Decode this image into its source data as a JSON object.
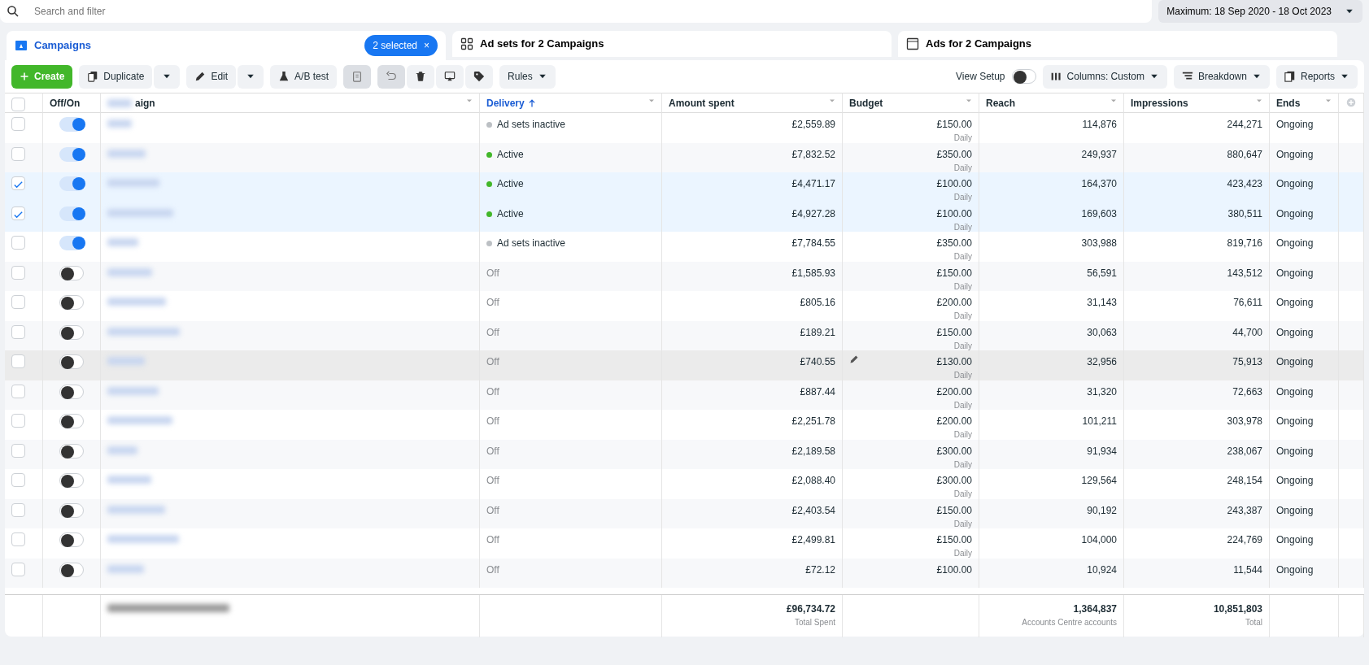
{
  "search": {
    "placeholder": "Search and filter"
  },
  "date_range": {
    "label": "Maximum: 18 Sep 2020 - 18 Oct 2023"
  },
  "tabs": [
    {
      "kind": "campaigns",
      "label": "Campaigns",
      "selected": true,
      "selection_chip": "2 selected",
      "chip_close": "×"
    },
    {
      "kind": "adsets",
      "label": "Ad sets for 2 Campaigns",
      "selected": false
    },
    {
      "kind": "ads",
      "label": "Ads for 2 Campaigns",
      "selected": false
    }
  ],
  "toolbar": {
    "create": "Create",
    "duplicate": "Duplicate",
    "edit": "Edit",
    "ab_test": "A/B test",
    "rules": "Rules",
    "view_setup": {
      "label": "View Setup",
      "on": false
    },
    "columns": "Columns: Custom",
    "breakdown": "Breakdown",
    "reports": "Reports"
  },
  "table": {
    "select_all_checked": false,
    "columns": [
      {
        "kind": "onoff",
        "label": "Off/On",
        "sorted": false
      },
      {
        "kind": "name",
        "label": "aign",
        "sorted": false
      },
      {
        "kind": "text",
        "label": "Delivery",
        "sorted": true
      },
      {
        "kind": "num",
        "label": "Amount spent",
        "sorted": false
      },
      {
        "kind": "num",
        "label": "Budget",
        "sorted": false
      },
      {
        "kind": "num",
        "label": "Reach",
        "sorted": false
      },
      {
        "kind": "num",
        "label": "Impressions",
        "sorted": false
      },
      {
        "kind": "text",
        "label": "Ends",
        "sorted": false
      }
    ],
    "rows": [
      {
        "selected": false,
        "on": true,
        "hovered": false,
        "delivery": "Ad sets inactive",
        "color": "#bcc0c4",
        "amount": "£2,559.89",
        "budget": "£150.00",
        "budget_period": "Daily",
        "reach": "114,876",
        "impressions": "244,271",
        "ends": "Ongoing"
      },
      {
        "selected": false,
        "on": true,
        "hovered": false,
        "delivery": "Active",
        "color": "#42b72a",
        "amount": "£7,832.52",
        "budget": "£350.00",
        "budget_period": "Daily",
        "reach": "249,937",
        "impressions": "880,647",
        "ends": "Ongoing"
      },
      {
        "selected": true,
        "on": true,
        "hovered": false,
        "delivery": "Active",
        "color": "#42b72a",
        "amount": "£4,471.17",
        "budget": "£100.00",
        "budget_period": "Daily",
        "reach": "164,370",
        "impressions": "423,423",
        "ends": "Ongoing"
      },
      {
        "selected": true,
        "on": true,
        "hovered": false,
        "delivery": "Active",
        "color": "#42b72a",
        "amount": "£4,927.28",
        "budget": "£100.00",
        "budget_period": "Daily",
        "reach": "169,603",
        "impressions": "380,511",
        "ends": "Ongoing"
      },
      {
        "selected": false,
        "on": true,
        "hovered": false,
        "delivery": "Ad sets inactive",
        "color": "#bcc0c4",
        "amount": "£7,784.55",
        "budget": "£350.00",
        "budget_period": "Daily",
        "reach": "303,988",
        "impressions": "819,716",
        "ends": "Ongoing"
      },
      {
        "selected": false,
        "on": false,
        "hovered": false,
        "delivery": "Off",
        "amount": "£1,585.93",
        "budget": "£150.00",
        "budget_period": "Daily",
        "reach": "56,591",
        "impressions": "143,512",
        "ends": "Ongoing"
      },
      {
        "selected": false,
        "on": false,
        "hovered": false,
        "delivery": "Off",
        "amount": "£805.16",
        "budget": "£200.00",
        "budget_period": "Daily",
        "reach": "31,143",
        "impressions": "76,611",
        "ends": "Ongoing"
      },
      {
        "selected": false,
        "on": false,
        "hovered": false,
        "delivery": "Off",
        "amount": "£189.21",
        "budget": "£150.00",
        "budget_period": "Daily",
        "reach": "30,063",
        "impressions": "44,700",
        "ends": "Ongoing"
      },
      {
        "selected": false,
        "on": false,
        "hovered": true,
        "delivery": "Off",
        "amount": "£740.55",
        "budget": "£130.00",
        "budget_period": "Daily",
        "reach": "32,956",
        "impressions": "75,913",
        "ends": "Ongoing"
      },
      {
        "selected": false,
        "on": false,
        "hovered": false,
        "delivery": "Off",
        "amount": "£887.44",
        "budget": "£200.00",
        "budget_period": "Daily",
        "reach": "31,320",
        "impressions": "72,663",
        "ends": "Ongoing"
      },
      {
        "selected": false,
        "on": false,
        "hovered": false,
        "delivery": "Off",
        "amount": "£2,251.78",
        "budget": "£200.00",
        "budget_period": "Daily",
        "reach": "101,211",
        "impressions": "303,978",
        "ends": "Ongoing"
      },
      {
        "selected": false,
        "on": false,
        "hovered": false,
        "delivery": "Off",
        "amount": "£2,189.58",
        "budget": "£300.00",
        "budget_period": "Daily",
        "reach": "91,934",
        "impressions": "238,067",
        "ends": "Ongoing"
      },
      {
        "selected": false,
        "on": false,
        "hovered": false,
        "delivery": "Off",
        "amount": "£2,088.40",
        "budget": "£300.00",
        "budget_period": "Daily",
        "reach": "129,564",
        "impressions": "248,154",
        "ends": "Ongoing"
      },
      {
        "selected": false,
        "on": false,
        "hovered": false,
        "delivery": "Off",
        "amount": "£2,403.54",
        "budget": "£150.00",
        "budget_period": "Daily",
        "reach": "90,192",
        "impressions": "243,387",
        "ends": "Ongoing"
      },
      {
        "selected": false,
        "on": false,
        "hovered": false,
        "delivery": "Off",
        "amount": "£2,499.81",
        "budget": "£150.00",
        "budget_period": "Daily",
        "reach": "104,000",
        "impressions": "224,769",
        "ends": "Ongoing"
      },
      {
        "selected": false,
        "on": false,
        "hovered": false,
        "delivery": "Off",
        "amount": "£72.12",
        "budget": "£100.00",
        "reach": "10,924",
        "impressions": "11,544",
        "ends": "Ongoing"
      }
    ],
    "totals": {
      "amount": "£96,734.72",
      "amount_note": "Total Spent",
      "reach": "1,364,837",
      "reach_note": "Accounts Centre accounts",
      "impressions": "10,851,803",
      "impressions_note": "Total"
    }
  }
}
